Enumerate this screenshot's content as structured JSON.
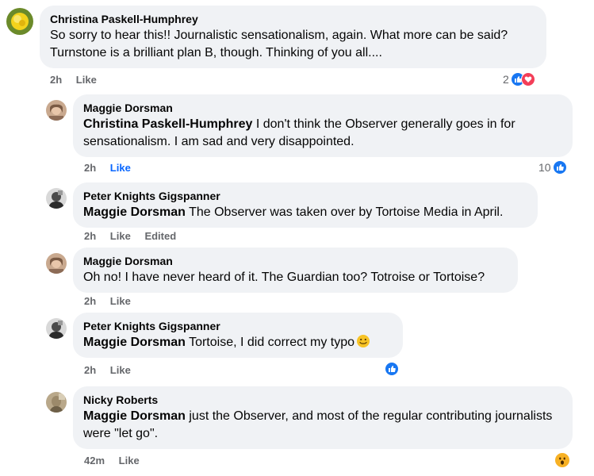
{
  "comments": [
    {
      "author": "Christina Paskell-Humphrey",
      "mention": "",
      "text": "So sorry to hear this!! Journalistic sensationalism, again. What more can be said? Turnstone is a brilliant plan B, though. Thinking of you all....",
      "time": "2h",
      "like": "Like",
      "reaction_count": "2",
      "reactions": [
        "like-icon",
        "love-icon"
      ]
    },
    {
      "author": "Maggie Dorsman",
      "mention": "Christina Paskell-Humphrey",
      "text": " I don't think the Observer generally goes in for sensationalism. I am sad and very disappointed.",
      "time": "2h",
      "like": "Like",
      "reaction_count": "10",
      "reactions": [
        "like-icon"
      ]
    },
    {
      "author": "Peter Knights Gigspanner",
      "mention": "Maggie Dorsman",
      "text": " The Observer was taken over by Tortoise Media in April.",
      "time": "2h",
      "like": "Like",
      "edited": "Edited"
    },
    {
      "author": "Maggie Dorsman",
      "mention": "",
      "text": "Oh no! I have never heard of it. The Guardian too? Totroise or Tortoise?",
      "time": "2h",
      "like": "Like"
    },
    {
      "author": "Peter Knights Gigspanner",
      "mention": "Maggie Dorsman",
      "text": " Tortoise, I did correct my typo",
      "time": "2h",
      "like": "Like",
      "reactions": [
        "like-icon"
      ]
    },
    {
      "author": "Nicky Roberts",
      "mention": "Maggie Dorsman",
      "text": " just the Observer, and most of the regular contributing journalists were \"let go\".",
      "time": "42m",
      "like": "Like",
      "reactions": [
        "wow-icon"
      ]
    }
  ],
  "colors": {
    "bubble": "#f0f2f5",
    "link": "#0866ff",
    "meta": "#65676b",
    "like": "#1877f2",
    "love": "#f33e58"
  }
}
